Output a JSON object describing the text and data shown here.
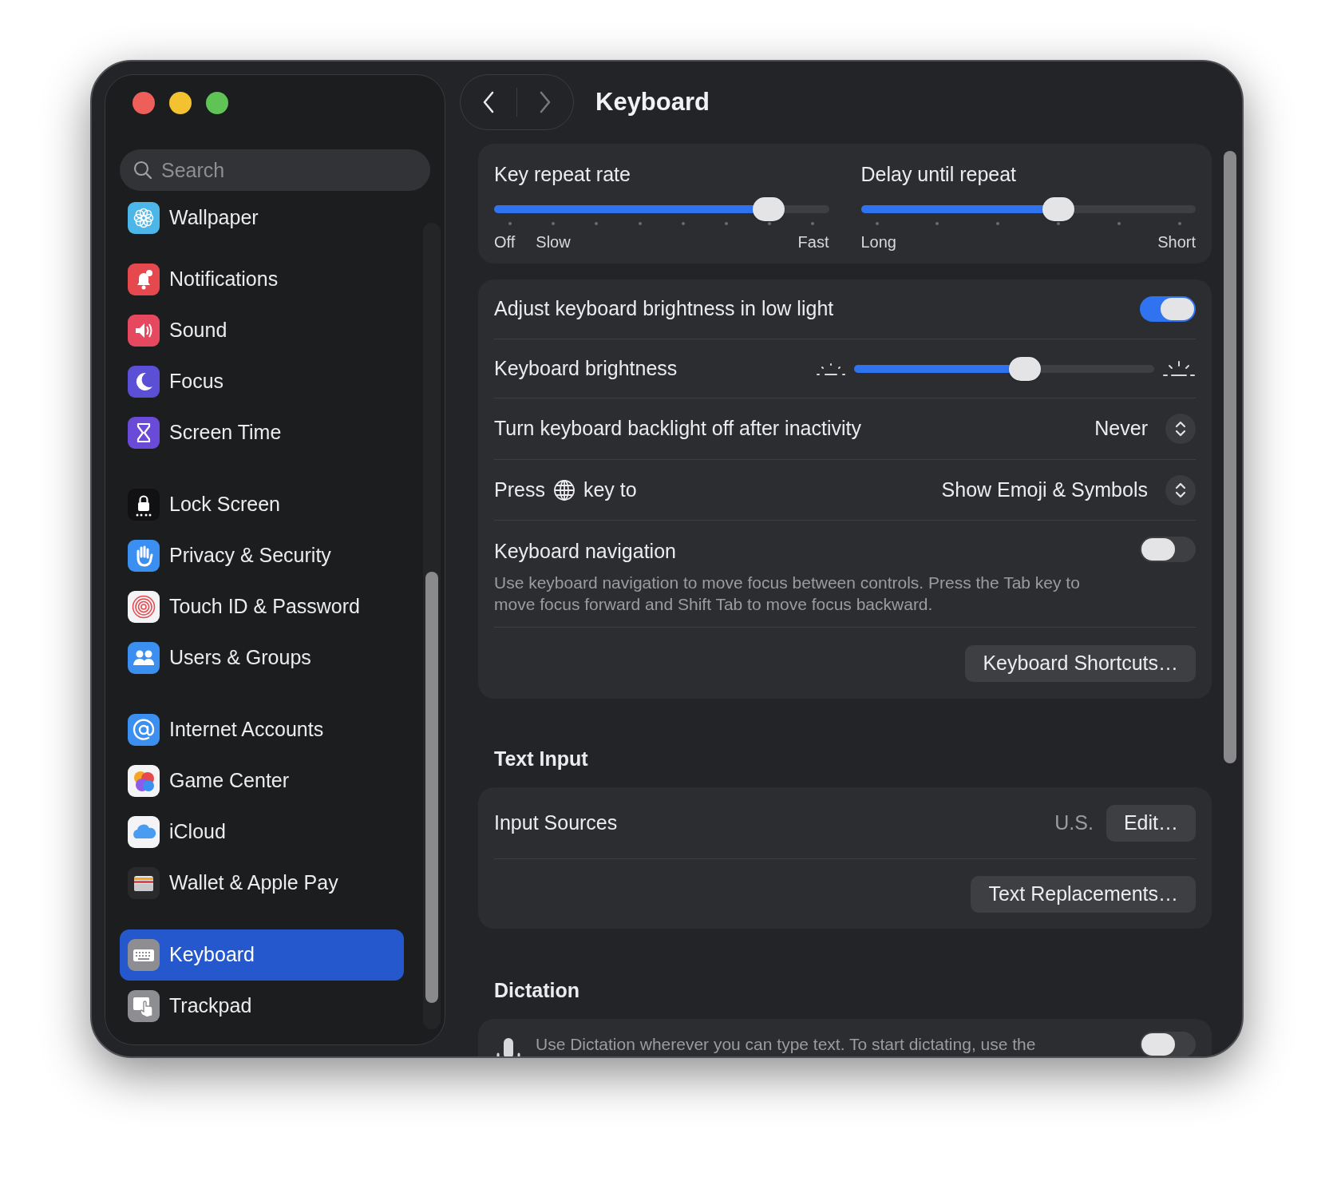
{
  "window": {
    "title": "Keyboard"
  },
  "sidebar": {
    "search": {
      "placeholder": "Search"
    },
    "groups": [
      [
        {
          "label": "Wallpaper",
          "selected": false
        }
      ],
      [
        {
          "label": "Notifications",
          "selected": false
        },
        {
          "label": "Sound",
          "selected": false
        },
        {
          "label": "Focus",
          "selected": false
        },
        {
          "label": "Screen Time",
          "selected": false
        }
      ],
      [
        {
          "label": "Lock Screen",
          "selected": false
        },
        {
          "label": "Privacy & Security",
          "selected": false
        },
        {
          "label": "Touch ID & Password",
          "selected": false
        },
        {
          "label": "Users & Groups",
          "selected": false
        }
      ],
      [
        {
          "label": "Internet Accounts",
          "selected": false
        },
        {
          "label": "Game Center",
          "selected": false
        },
        {
          "label": "iCloud",
          "selected": false
        },
        {
          "label": "Wallet & Apple Pay",
          "selected": false
        }
      ],
      [
        {
          "label": "Keyboard",
          "selected": true
        },
        {
          "label": "Trackpad",
          "selected": false
        }
      ]
    ]
  },
  "repeat_sliders": [
    {
      "label": "Key repeat rate",
      "level": 0.82,
      "tick_labels": [
        "Off",
        "Slow",
        "Fast"
      ]
    },
    {
      "label": "Delay until repeat",
      "level": 0.59,
      "tick_labels": [
        "Long",
        "Short"
      ]
    }
  ],
  "keyboard_settings": [
    {
      "kind": "toggle",
      "label": "Adjust keyboard brightness in low light",
      "on": true
    },
    {
      "kind": "slider",
      "label": "Keyboard brightness",
      "level": 0.57
    },
    {
      "kind": "popup",
      "label": "Turn keyboard backlight off after inactivity",
      "value": "Never"
    },
    {
      "kind": "globe_popup",
      "label": "Press",
      "label_after": "key to",
      "value": "Show Emoji & Symbols"
    },
    {
      "kind": "toggle",
      "label": "Keyboard navigation",
      "description": "Use keyboard navigation to move focus between controls. Press the Tab key to move focus forward and Shift Tab to move focus backward.",
      "on": false
    },
    {
      "kind": "button",
      "button": "Keyboard Shortcuts…"
    }
  ],
  "text_input": {
    "title": "Text Input",
    "rows": [
      {
        "kind": "value_button",
        "label": "Input Sources",
        "value": "U.S.",
        "button": "Edit…"
      },
      {
        "kind": "button",
        "button": "Text Replacements…"
      }
    ]
  },
  "dictation": {
    "title": "Dictation",
    "description": "Use Dictation wherever you can type text. To start dictating, use the",
    "on": false
  }
}
